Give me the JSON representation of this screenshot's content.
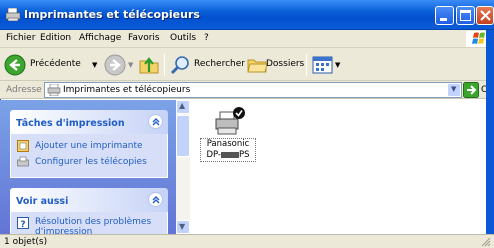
{
  "window": {
    "title": "Imprimantes et télécopieurs"
  },
  "menu": {
    "items": [
      "Fichier",
      "Edition",
      "Affichage",
      "Favoris",
      "Outils",
      "?"
    ]
  },
  "toolbar": {
    "back_label": "Précédente",
    "search_label": "Rechercher",
    "folders_label": "Dossiers"
  },
  "address": {
    "label": "Adresse",
    "value": "Imprimantes et télécopieurs",
    "go_label": "OK"
  },
  "tasks_panel": {
    "title": "Tâches d'impression",
    "items": [
      "Ajouter une imprimante",
      "Configurer les télécopies"
    ]
  },
  "see_also_panel": {
    "title": "Voir aussi",
    "items": [
      "Résolution des problèmes",
      "d'impression"
    ]
  },
  "printer": {
    "line1": "Panasonic",
    "line2_prefix": "DP-",
    "line2_suffix": "PS"
  },
  "status": {
    "text": "1 objet(s)"
  },
  "colors": {
    "titlebar": "#0a5fd8",
    "chrome": "#ece9d8",
    "taskpane": "#6d8fe0",
    "link": "#215dc6"
  }
}
